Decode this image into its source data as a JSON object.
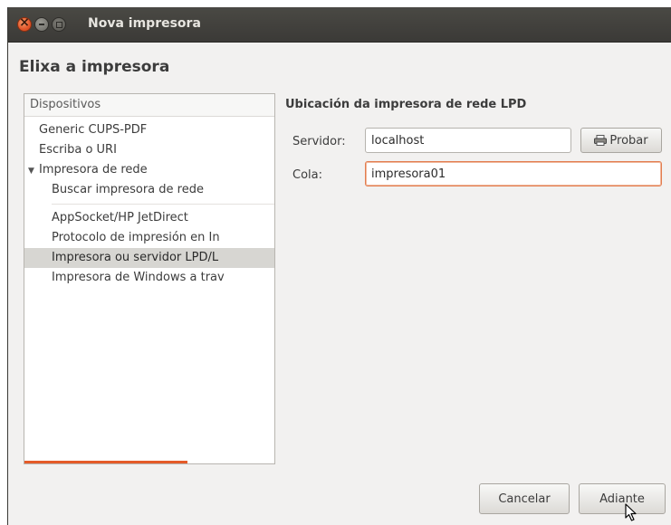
{
  "window": {
    "title": "Nova impresora"
  },
  "page": {
    "heading": "Elixa a impresora"
  },
  "sidebar": {
    "header": "Dispositivos",
    "items": [
      {
        "label": "Generic CUPS-PDF"
      },
      {
        "label": "Escriba o URI"
      },
      {
        "label": "Impresora de rede",
        "expanded": true
      },
      {
        "label": "Buscar impresora de rede"
      },
      {
        "label": "AppSocket/HP JetDirect"
      },
      {
        "label": "Protocolo de impresión en In"
      },
      {
        "label": "Impresora ou servidor LPD/L",
        "selected": true
      },
      {
        "label": "Impresora de Windows a trav"
      }
    ]
  },
  "main": {
    "section_title": "Ubicación da impresora de rede LPD",
    "server_label": "Servidor:",
    "server_value": "localhost",
    "probe_button": "Probar",
    "queue_label": "Cola:",
    "queue_value": "impresora01"
  },
  "footer": {
    "cancel": "Cancelar",
    "forward": "Adiante"
  },
  "colors": {
    "accent": "#e55b29",
    "titlebar": "#3c3b37"
  }
}
